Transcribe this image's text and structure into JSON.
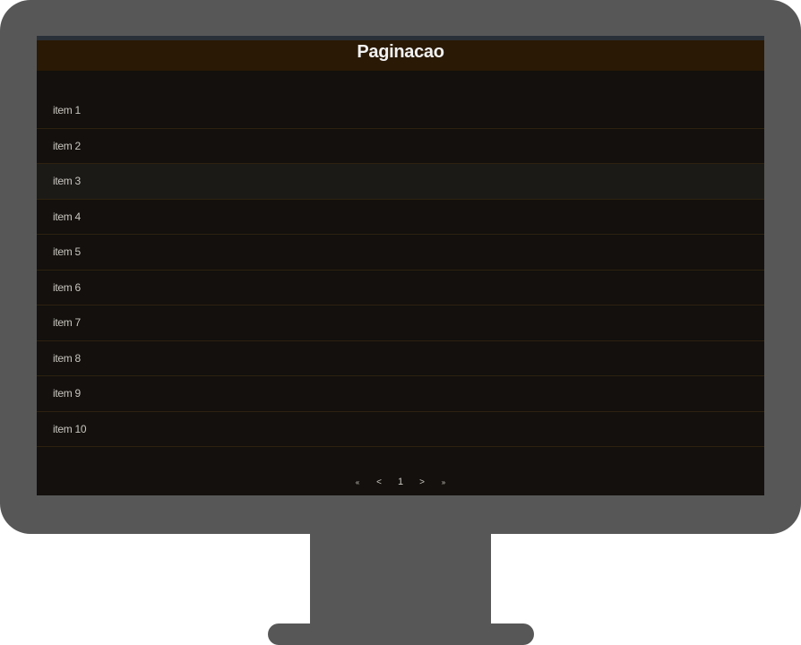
{
  "header": {
    "title": "Paginacao"
  },
  "list": {
    "items": [
      {
        "label": "item 1"
      },
      {
        "label": "item 2"
      },
      {
        "label": "item 3"
      },
      {
        "label": "item 4"
      },
      {
        "label": "item 5"
      },
      {
        "label": "item 6"
      },
      {
        "label": "item 7"
      },
      {
        "label": "item 8"
      },
      {
        "label": "item 9"
      },
      {
        "label": "item 10"
      }
    ],
    "hovered_index": 2
  },
  "pagination": {
    "first": "«",
    "prev": "<",
    "current_page": "1",
    "next": ">",
    "last": "»"
  },
  "colors": {
    "screen_bg": "#13100d",
    "header_bg": "#2a1905",
    "row_divider": "#2e2210",
    "monitor_frame": "#575757"
  }
}
